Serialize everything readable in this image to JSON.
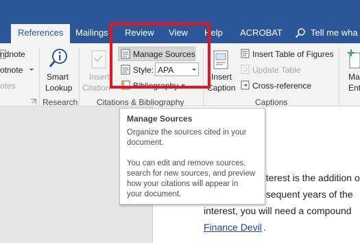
{
  "tabs": [
    {
      "label": "References",
      "active": true
    },
    {
      "label": "Mailings"
    },
    {
      "label": "Review"
    },
    {
      "label": "View"
    },
    {
      "label": "Help"
    },
    {
      "label": "ACROBAT"
    }
  ],
  "tell_me": "Tell me wha",
  "ribbon": {
    "footnotes_partial": {
      "line1": "ndnote",
      "line2": "otnote",
      "line3": "otes"
    },
    "smart_lookup": {
      "line1": "Smart",
      "line2": "Lookup"
    },
    "insert_citation": {
      "line1": "Insert",
      "line2": "Citation"
    },
    "manage_sources": "Manage Sources",
    "style_label": "Style:",
    "style_value": "APA",
    "bibliography": "Bibliography",
    "insert_caption": {
      "line1": "Insert",
      "line2": "Caption"
    },
    "insert_table_of_figures": "Insert Table of Figures",
    "update_table": "Update Table",
    "cross_reference": "Cross-reference",
    "mark_entry_partial": {
      "line1": "Ma",
      "line2": "Ent"
    },
    "groups": {
      "research": "Research",
      "citations": "Citations & Bibliography",
      "captions": "Captions"
    }
  },
  "tooltip": {
    "title": "Manage Sources",
    "para1": [
      "Organize the sources cited in your",
      "document."
    ],
    "para2": [
      "You can edit and remove sources,",
      "search for new sources, and preview",
      "how your citations will appear in",
      "your document."
    ]
  },
  "document": {
    "line1": "nterest is the addition o",
    "line2": "bsequent years of the",
    "line3": "interest, you will need a compound",
    "link": "Finance Devil",
    "period": "."
  },
  "colors": {
    "tab_bar": "#2b579a",
    "ribbon": "#f3f3f3",
    "highlight": "#e8141d",
    "link": "#1f3fa6"
  }
}
